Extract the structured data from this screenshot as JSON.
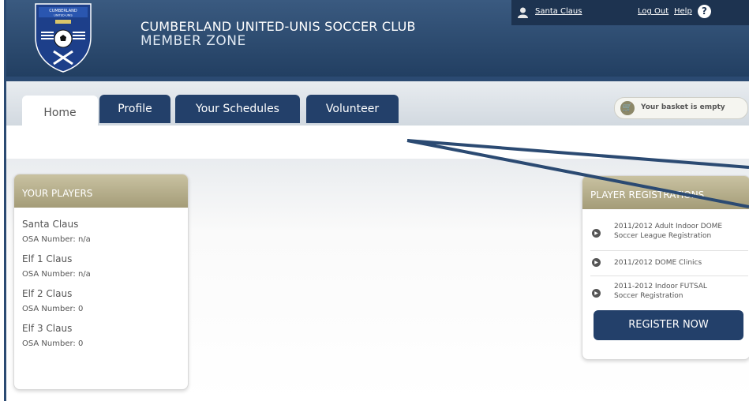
{
  "header": {
    "club_name": "CUMBERLAND UNITED-UNIS SOCCER CLUB",
    "zone_name": "MEMBER ZONE",
    "logo_text": "CUMBERLAND UNITED-UNIS",
    "user_name": "Santa Claus",
    "logout_label": "Log Out",
    "help_label": "Help",
    "help_icon": "?"
  },
  "tabs": [
    {
      "label": "Home",
      "active": true
    },
    {
      "label": "Profile",
      "active": false
    },
    {
      "label": "Your Schedules",
      "active": false
    },
    {
      "label": "Volunteer",
      "active": false
    }
  ],
  "basket": {
    "label": "Your basket is empty",
    "icon": "cart-icon"
  },
  "players_panel": {
    "title": "YOUR PLAYERS",
    "players": [
      {
        "name": "Santa Claus",
        "osa": "OSA Number: n/a"
      },
      {
        "name": "Elf 1 Claus",
        "osa": "OSA Number: n/a"
      },
      {
        "name": "Elf 2 Claus",
        "osa": "OSA Number: 0"
      },
      {
        "name": "Elf 3 Claus",
        "osa": "OSA Number: 0"
      }
    ]
  },
  "registrations_panel": {
    "title": "PLAYER REGISTRATIONS",
    "items": [
      {
        "line1": "2011/2012 Adult Indoor DOME",
        "line2": "Soccer League Registration"
      },
      {
        "line1": "2011/2012 DOME Clinics",
        "line2": ""
      },
      {
        "line1": "2011-2012 Indoor FUTSAL",
        "line2": "Soccer Registration"
      }
    ],
    "button_label": "REGISTER NOW"
  },
  "colors": {
    "header_bg": "#2c4b70",
    "tab_dark": "#23406a",
    "panel_head": "#b3ac8a",
    "annotation_line": "#2b4a72"
  }
}
